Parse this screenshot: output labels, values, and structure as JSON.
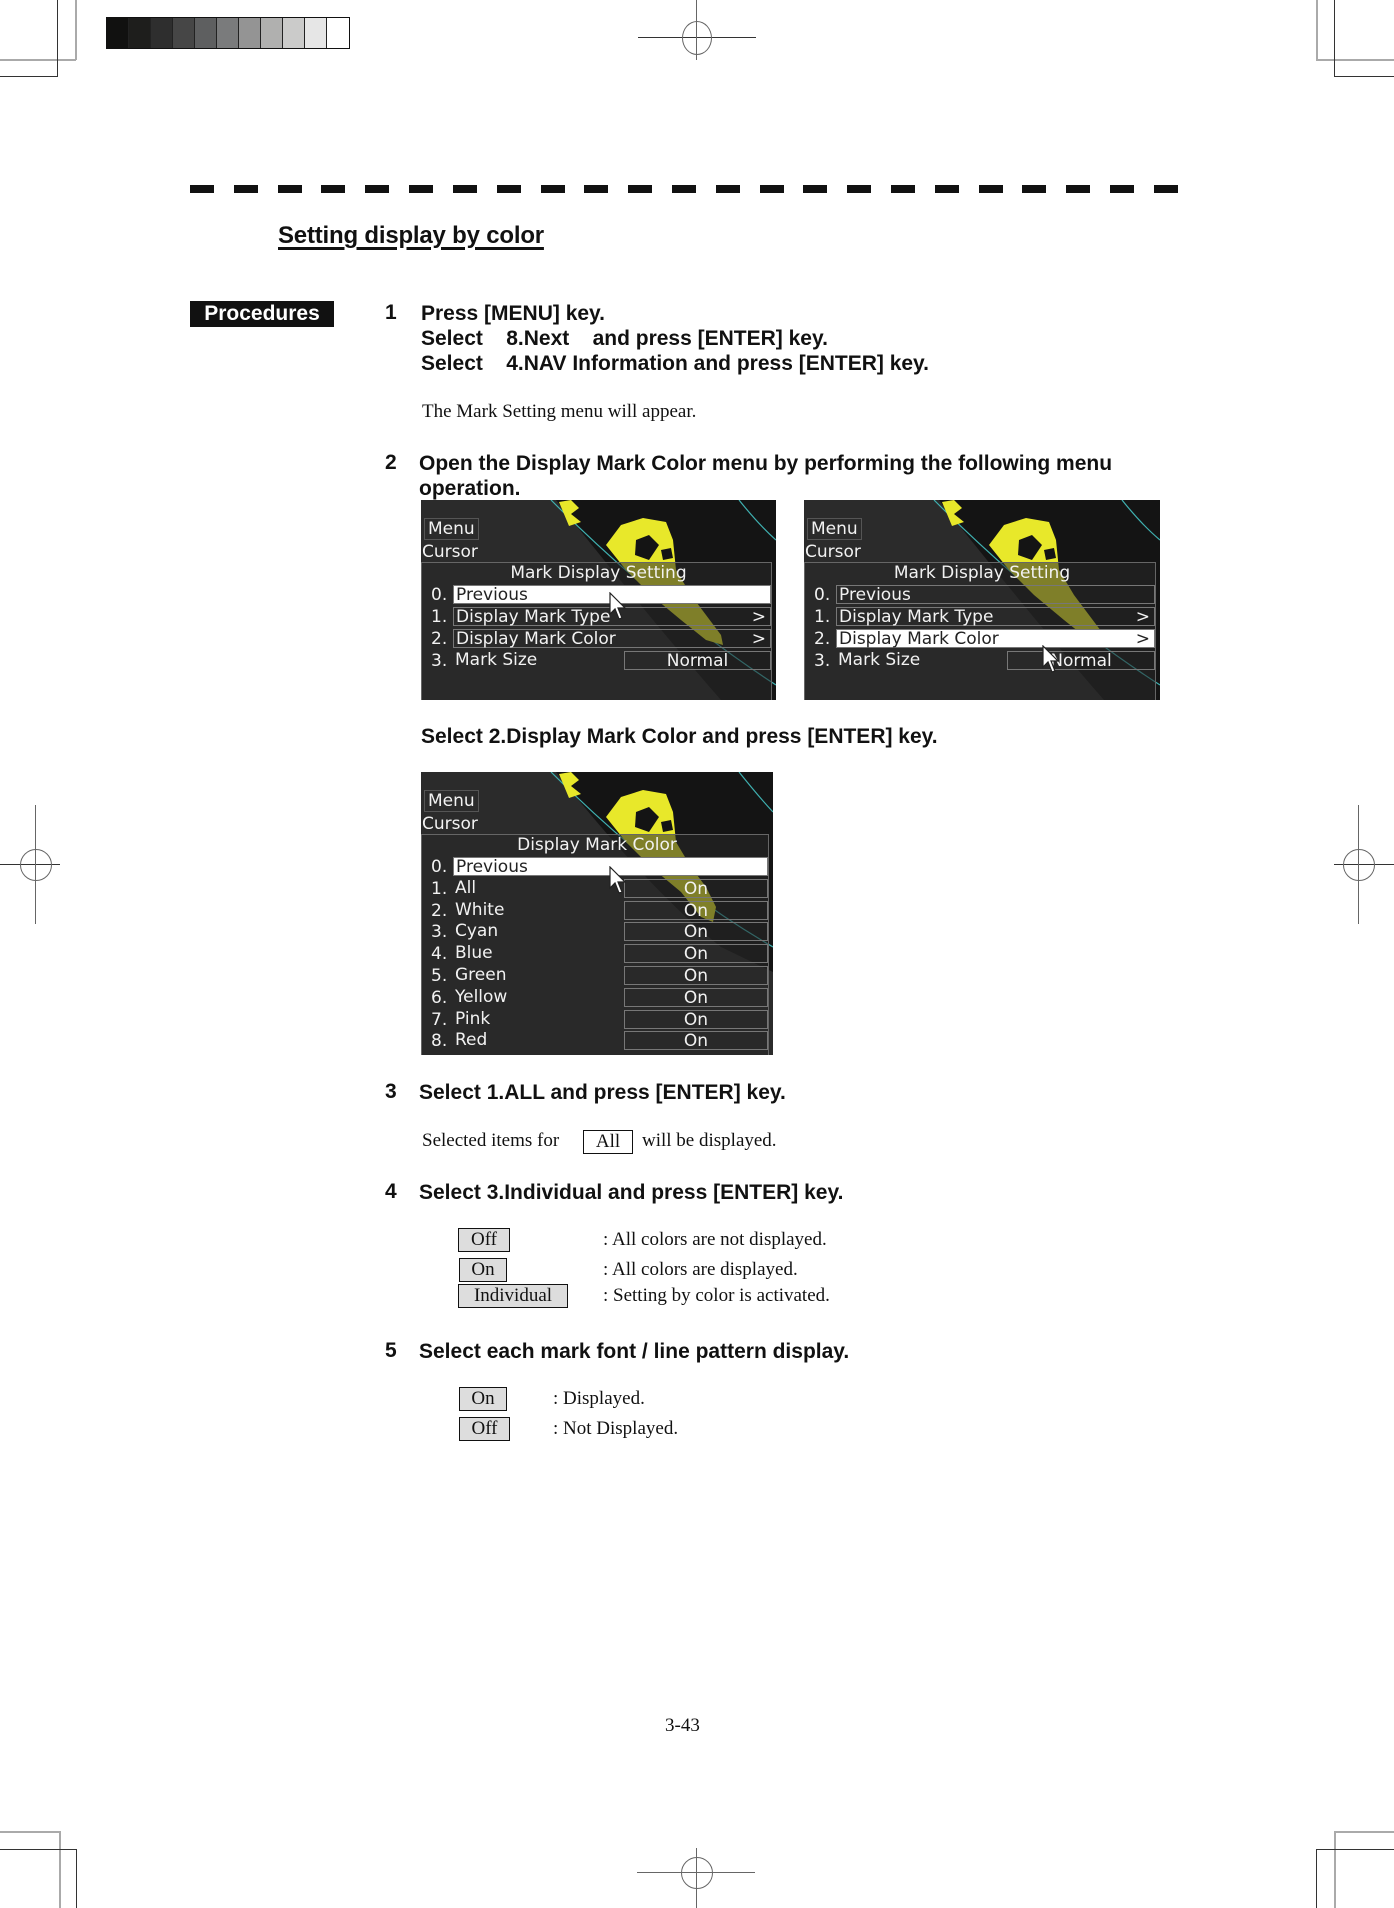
{
  "grayscale": [
    "#111110",
    "#1e1e1c",
    "#2e2e2e",
    "#464646",
    "#5e5f60",
    "#7a7b7c",
    "#949494",
    "#b0b0af",
    "#cbcbca",
    "#e6e6e6",
    "#ffffff"
  ],
  "heading": "Setting display by color",
  "procedures_badge": "Procedures",
  "steps": [
    {
      "number": "1",
      "lines": [
        "Press [MENU] key.",
        "Select    8.Next    and press [ENTER] key.",
        "Select    4.NAV Information and press [ENTER] key."
      ],
      "note": "The Mark Setting menu will appear."
    },
    {
      "number": "2",
      "lines": [
        "Open the Display Mark Color menu by performing the following menu",
        "operation."
      ],
      "sub_instruction": "Select 2.Display Mark Color and press [ENTER] key."
    },
    {
      "number": "3",
      "lines": [
        "Select 1.ALL and press [ENTER] key."
      ],
      "note_prefix": "Selected items for",
      "note_box": "All",
      "note_suffix": "will be displayed."
    },
    {
      "number": "4",
      "lines": [
        "Select 3.Individual and press [ENTER] key."
      ],
      "options": [
        {
          "label": "Off",
          "desc": ": All colors are not displayed."
        },
        {
          "label": "On",
          "desc": ": All colors are displayed."
        },
        {
          "label": "Individual",
          "desc": ": Setting by color is activated."
        }
      ]
    },
    {
      "number": "5",
      "lines": [
        "Select each mark font / line pattern display."
      ],
      "options": [
        {
          "label": "On",
          "desc": ": Displayed."
        },
        {
          "label": "Off",
          "desc": ": Not Displayed."
        }
      ]
    }
  ],
  "screens": {
    "common": {
      "menu_label": "Menu",
      "cursor_label": "Cursor"
    },
    "mark_display_setting": {
      "title": "Mark Display Setting",
      "items": [
        {
          "index": "0.",
          "label": "Previous",
          "arrow": "",
          "value": ""
        },
        {
          "index": "1.",
          "label": "Display Mark Type",
          "arrow": ">",
          "value": ""
        },
        {
          "index": "2.",
          "label": "Display Mark Color",
          "arrow": ">",
          "value": ""
        },
        {
          "index": "3.",
          "label": "Mark Size",
          "arrow": "",
          "value": "Normal"
        }
      ]
    },
    "display_mark_color": {
      "title": "Display Mark Color",
      "items": [
        {
          "index": "0.",
          "label": "Previous",
          "value": ""
        },
        {
          "index": "1.",
          "label": "All",
          "value": "On"
        },
        {
          "index": "2.",
          "label": "White",
          "value": "On"
        },
        {
          "index": "3.",
          "label": "Cyan",
          "value": "On"
        },
        {
          "index": "4.",
          "label": "Blue",
          "value": "On"
        },
        {
          "index": "5.",
          "label": "Green",
          "value": "On"
        },
        {
          "index": "6.",
          "label": "Yellow",
          "value": "On"
        },
        {
          "index": "7.",
          "label": "Pink",
          "value": "On"
        },
        {
          "index": "8.",
          "label": "Red",
          "value": "On"
        }
      ]
    },
    "colors": {
      "background": "#2b2b2b",
      "land_echo": "#e8e82a",
      "range_ring": "#3fb0b0",
      "highlight": "#ffffff"
    }
  },
  "page_number": "3-43"
}
